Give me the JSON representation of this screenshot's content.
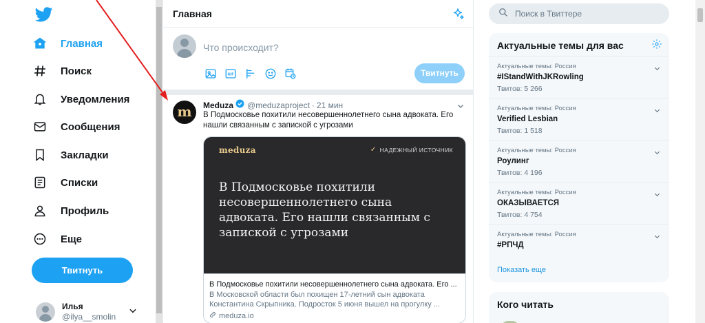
{
  "colors": {
    "accent": "#1da1f2",
    "annotation_arrow": "#e41e1e",
    "text": "#14171a",
    "muted": "#657786"
  },
  "nav": {
    "logo_icon": "twitter-bird-icon",
    "items": [
      {
        "label": "Главная",
        "icon": "home-icon",
        "active": true
      },
      {
        "label": "Поиск",
        "icon": "hashtag-icon"
      },
      {
        "label": "Уведомления",
        "icon": "bell-icon"
      },
      {
        "label": "Сообщения",
        "icon": "envelope-icon"
      },
      {
        "label": "Закладки",
        "icon": "bookmark-icon"
      },
      {
        "label": "Списки",
        "icon": "list-icon"
      },
      {
        "label": "Профиль",
        "icon": "person-icon"
      },
      {
        "label": "Еще",
        "icon": "more-circle-icon"
      }
    ],
    "tweet_button": "Твитнуть",
    "account": {
      "name": "Илья",
      "handle": "@ilya__smolin"
    }
  },
  "main": {
    "title": "Главная",
    "compose": {
      "placeholder": "Что происходит?",
      "button": "Твитнуть"
    },
    "tweet": {
      "author": "Meduza",
      "handle": "@meduzaproject",
      "dot": "·",
      "time": "21 мин",
      "text": "В Подмосковье похитили несовершеннолетнего сына адвоката. Его нашли связанным с запиской с угрозами",
      "card": {
        "brand": "meduza",
        "badge": "НАДЕЖНЫЙ ИСТОЧНИК",
        "headline": "В Подмосковье похитили несовершеннолетнего сына адвоката. Его нашли связанным с запиской с угрозами",
        "title": "В Подмосковье похитили несовершеннолетнего сына адвоката. Его ...",
        "description": "В Московской области был похищен 17-летний сын адвоката Константина Скрыпника. Подросток 5 июня вышел на прогулку ...",
        "domain": "meduza.io"
      }
    }
  },
  "right": {
    "search_placeholder": "Поиск в Твиттере",
    "trends": {
      "title": "Актуальные темы для вас",
      "items": [
        {
          "context": "Актуальные темы: Россия",
          "name": "#IStandWithJKRowling",
          "count": "Твитов: 5 266"
        },
        {
          "context": "Актуальные темы: Россия",
          "name": "Verified Lesbian",
          "count": "Твитов: 1 518"
        },
        {
          "context": "Актуальные темы: Россия",
          "name": "Роулинг",
          "count": "Твитов: 4 196"
        },
        {
          "context": "Актуальные темы: Россия",
          "name": "ОКАЗЫВАЕТСЯ",
          "count": "Твитов: 4 754"
        },
        {
          "context": "Актуальные темы: Россия",
          "name": "#РПЧД",
          "count": ""
        }
      ],
      "show_more": "Показать еще"
    },
    "who_to_follow": {
      "title": "Кого читать"
    }
  }
}
